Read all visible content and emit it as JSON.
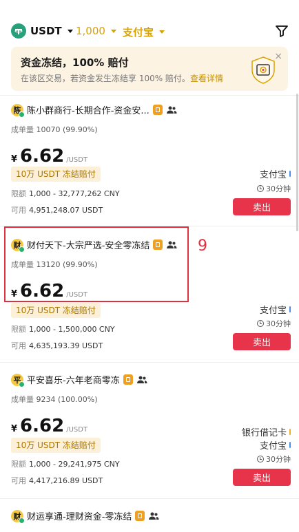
{
  "topbar": {
    "coin": "USDT",
    "amount": "1,000",
    "payment": "支付宝"
  },
  "banner": {
    "title": "资金冻结，100% 赔付",
    "desc": "在该区交易，若资金发生冻结享 100% 赔付。",
    "link": "查看详情",
    "close": "×"
  },
  "currency_symbol": "¥",
  "unit": "/USDT",
  "labels": {
    "orders": "成单量",
    "limit": "限额",
    "available": "可用",
    "sell": "卖出"
  },
  "highlight_label": "9",
  "cards": [
    {
      "avatar": "陈",
      "name": "陈小群商行-长期合作-资金安...",
      "orders": "10070 (99.90%)",
      "price": "6.62",
      "tag": "10万 USDT 冻结赔付",
      "limit": "1,000 - 32,777,262 CNY",
      "available": "4,951,248.07 USDT",
      "methods": [
        "支付宝"
      ],
      "time": "30分钟"
    },
    {
      "avatar": "财",
      "name": "财付天下-大宗严选-安全零冻结",
      "orders": "13120 (99.90%)",
      "price": "6.62",
      "tag": "10万 USDT 冻结赔付",
      "limit": "1,000 - 1,500,000 CNY",
      "available": "4,635,193.39 USDT",
      "methods": [
        "支付宝"
      ],
      "time": "30分钟"
    },
    {
      "avatar": "平",
      "name": "平安喜乐-六年老商零冻",
      "orders": "9234 (100.00%)",
      "price": "6.62",
      "tag": "10万 USDT 冻结赔付",
      "limit": "1,000 - 29,241,975 CNY",
      "available": "4,417,216.89 USDT",
      "methods": [
        "银行借记卡",
        "支付宝"
      ],
      "time": "30分钟"
    },
    {
      "avatar": "财",
      "name": "财运享通-理财资金-零冻结"
    }
  ],
  "colors": {
    "gold": "#d9a300",
    "sell": "#e8344a",
    "highlight": "#e03040",
    "tether": "#26a17b"
  }
}
